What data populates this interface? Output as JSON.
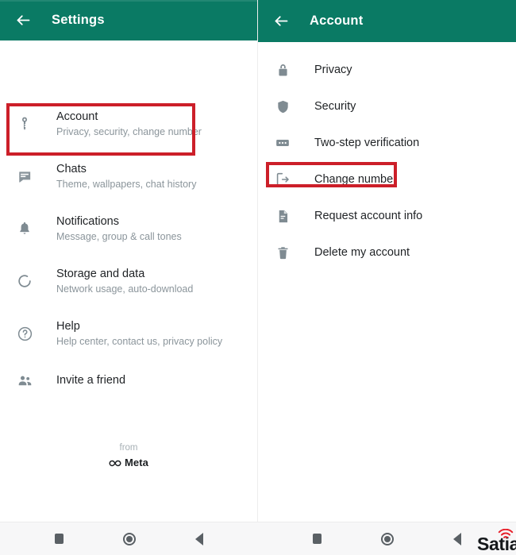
{
  "app": {
    "accent_green": "#0a7a64",
    "highlight_red": "#cc1f29",
    "nav_background": "#f7f7f8"
  },
  "left_pane": {
    "header": {
      "back_icon": "arrow-left-icon",
      "title": "Settings"
    },
    "items": [
      {
        "icon": "key-icon",
        "title": "Account",
        "subtitle": "Privacy, security, change number",
        "highlighted": true
      },
      {
        "icon": "chat-icon",
        "title": "Chats",
        "subtitle": "Theme, wallpapers, chat history",
        "highlighted": false
      },
      {
        "icon": "bell-icon",
        "title": "Notifications",
        "subtitle": "Message, group & call tones",
        "highlighted": false
      },
      {
        "icon": "data-circle-icon",
        "title": "Storage and data",
        "subtitle": "Network usage, auto-download",
        "highlighted": false
      },
      {
        "icon": "help-circle-icon",
        "title": "Help",
        "subtitle": "Help center, contact us, privacy policy",
        "highlighted": false
      },
      {
        "icon": "people-icon",
        "title": "Invite a friend",
        "subtitle": "",
        "highlighted": false
      }
    ],
    "branding": {
      "from_label": "from",
      "brand_name": "Meta",
      "brand_icon": "meta-infinity-icon"
    }
  },
  "right_pane": {
    "header": {
      "back_icon": "arrow-left-icon",
      "title": "Account"
    },
    "items": [
      {
        "icon": "lock-icon",
        "title": "Privacy",
        "highlighted": false
      },
      {
        "icon": "shield-icon",
        "title": "Security",
        "highlighted": false
      },
      {
        "icon": "dots-box-icon",
        "title": "Two-step verification",
        "highlighted": false
      },
      {
        "icon": "change-number-icon",
        "title": "Change number",
        "highlighted": true
      },
      {
        "icon": "document-icon",
        "title": "Request account info",
        "highlighted": false
      },
      {
        "icon": "trash-icon",
        "title": "Delete my account",
        "highlighted": false
      }
    ]
  },
  "system_nav": {
    "buttons": [
      "recents-square-button",
      "home-circle-button",
      "back-triangle-button"
    ]
  },
  "watermark": {
    "text": "Satia",
    "icon": "wifi-signal-icon",
    "icon_color": "#e8212b"
  }
}
